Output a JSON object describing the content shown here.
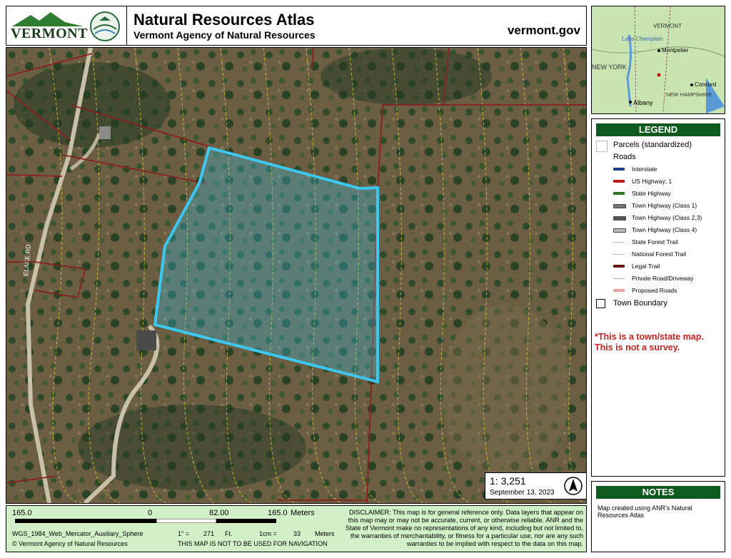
{
  "header": {
    "logo_text": "VERMONT",
    "title": "Natural Resources Atlas",
    "subtitle": "Vermont Agency of Natural Resources",
    "website": "vermont.gov"
  },
  "map": {
    "road_label": "ELAKE RD",
    "scale_ratio": "1:  3,251",
    "date": "September 13, 2023",
    "colors": {
      "parcel_highlight": "#3cc8f0",
      "parcel_lines": "#8a1f1f",
      "contours": "#e8d040"
    }
  },
  "locator": {
    "labels": [
      "VERMONT",
      "Lake Champlain",
      "Montpelier",
      "NEW YORK",
      "Concord",
      "NEW HAMPSHIRE",
      "Albany"
    ]
  },
  "legend": {
    "title": "LEGEND",
    "parcels": "Parcels (standardized)",
    "roads": "Roads",
    "items": [
      {
        "label": "Interstate",
        "color": "#1f3f8a"
      },
      {
        "label": "US Highway; 1",
        "color": "#c01818"
      },
      {
        "label": "State Highway",
        "color": "#2a7a1a"
      },
      {
        "label": "Town Highway (Class 1)",
        "color": "#777777"
      },
      {
        "label": "Town Highway (Class 2,3)",
        "color": "#555555"
      },
      {
        "label": "Town Highway (Class 4)",
        "color": "#bbbbbb"
      },
      {
        "label": "State Forest Trail",
        "color": "#999999"
      },
      {
        "label": "National Forest Trail",
        "color": "#999999"
      },
      {
        "label": "Legal Trail",
        "color": "#6a1414"
      },
      {
        "label": "Private Road/Driveway",
        "color": "#888888"
      },
      {
        "label": "Proposed Roads",
        "color": "#f0a0a0"
      }
    ],
    "town_boundary": "Town Boundary",
    "survey_line1": "*This is a town/state map.",
    "survey_line2": "This is not a survey."
  },
  "notes": {
    "title": "NOTES",
    "text": "Map created using ANR's Natural Resources Atlas"
  },
  "footer": {
    "scale_left": "165.0",
    "scale_zero": "0",
    "scale_mid": "82.00",
    "scale_right": "165.0",
    "scale_unit": "Meters",
    "projection": "WGS_1984_Web_Mercator_Auxiliary_Sphere",
    "copyright": "© Vermont Agency of Natural Resources",
    "inch_label": "1\" =",
    "inch_value": "271",
    "inch_unit": "Ft.",
    "cm_label": "1cm =",
    "cm_value": "33",
    "cm_unit": "Meters",
    "navigation_warning": "THIS MAP IS NOT TO BE USED FOR NAVIGATION",
    "disclaimer": "DISCLAIMER: This map is for general reference only. Data layers that appear on this map may or may not be accurate, current, or otherwise reliable. ANR and the State of Vermont make no representations of any kind, including but not limited to, the warranties of merchantability, or fitness for a particular use, nor are any such warranties to be implied with respect to the data on this map."
  }
}
